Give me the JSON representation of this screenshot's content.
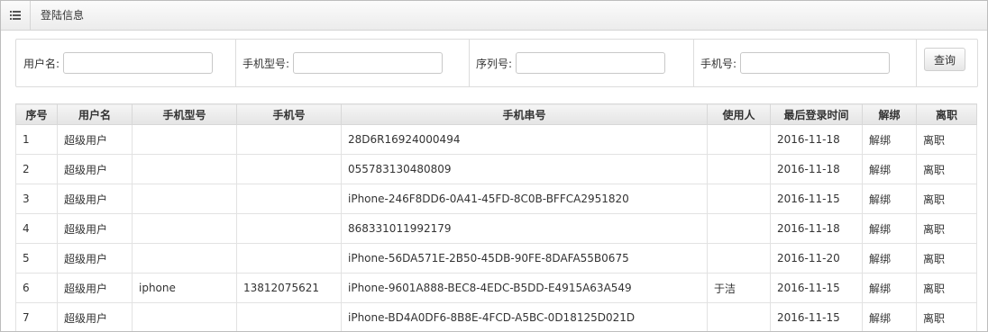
{
  "header": {
    "title": "登陆信息",
    "icon": "list-icon"
  },
  "search": {
    "username_label": "用户名:",
    "model_label": "手机型号:",
    "serial_label": "序列号:",
    "phone_label": "手机号:",
    "username_value": "",
    "model_value": "",
    "serial_value": "",
    "phone_value": "",
    "query_button": "查询"
  },
  "table": {
    "columns": [
      "序号",
      "用户名",
      "手机型号",
      "手机号",
      "手机串号",
      "使用人",
      "最后登录时间",
      "解绑",
      "离职"
    ],
    "rows": [
      {
        "no": "1",
        "user": "超级用户",
        "model": "",
        "phone": "",
        "imei": "28D6R16924000494",
        "owner": "",
        "last_login": "2016-11-18",
        "unbind": "解绑",
        "resign": "离职"
      },
      {
        "no": "2",
        "user": "超级用户",
        "model": "",
        "phone": "",
        "imei": "055783130480809",
        "owner": "",
        "last_login": "2016-11-18",
        "unbind": "解绑",
        "resign": "离职"
      },
      {
        "no": "3",
        "user": "超级用户",
        "model": "",
        "phone": "",
        "imei": "iPhone-246F8DD6-0A41-45FD-8C0B-BFFCA2951820",
        "owner": "",
        "last_login": "2016-11-15",
        "unbind": "解绑",
        "resign": "离职"
      },
      {
        "no": "4",
        "user": "超级用户",
        "model": "",
        "phone": "",
        "imei": "868331011992179",
        "owner": "",
        "last_login": "2016-11-18",
        "unbind": "解绑",
        "resign": "离职"
      },
      {
        "no": "5",
        "user": "超级用户",
        "model": "",
        "phone": "",
        "imei": "iPhone-56DA571E-2B50-45DB-90FE-8DAFA55B0675",
        "owner": "",
        "last_login": "2016-11-20",
        "unbind": "解绑",
        "resign": "离职"
      },
      {
        "no": "6",
        "user": "超级用户",
        "model": "iphone",
        "phone": "13812075621",
        "imei": "iPhone-9601A888-BEC8-4EDC-B5DD-E4915A63A549",
        "owner": "于洁",
        "last_login": "2016-11-15",
        "unbind": "解绑",
        "resign": "离职"
      },
      {
        "no": "7",
        "user": "超级用户",
        "model": "",
        "phone": "",
        "imei": "iPhone-BD4A0DF6-8B8E-4FCD-A5BC-0D18125D021D",
        "owner": "",
        "last_login": "2016-11-15",
        "unbind": "解绑",
        "resign": "离职"
      }
    ]
  }
}
